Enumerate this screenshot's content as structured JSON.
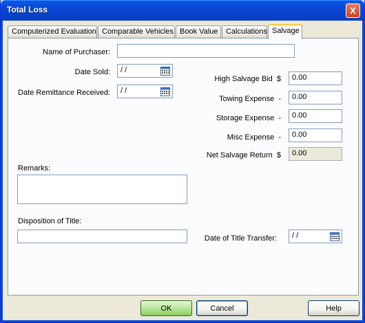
{
  "window": {
    "title": "Total Loss",
    "close_glyph": "X"
  },
  "tabs": [
    {
      "label": "Computerized Evaluation"
    },
    {
      "label": "Comparable Vehicles"
    },
    {
      "label": "Book Value"
    },
    {
      "label": "Calculations"
    },
    {
      "label": "Salvage"
    }
  ],
  "active_tab": "Salvage",
  "form": {
    "name_of_purchaser": {
      "label": "Name of Purchaser:",
      "value": ""
    },
    "date_sold": {
      "label": "Date Sold:",
      "value": " / /"
    },
    "date_remittance": {
      "label": "Date Remittance Received:",
      "value": " / /"
    },
    "remarks": {
      "label": "Remarks:",
      "value": ""
    },
    "disposition": {
      "label": "Disposition of Title:",
      "value": ""
    },
    "date_title_transfer": {
      "label": "Date of Title Transfer:",
      "value": " / /"
    },
    "high_salvage_bid": {
      "label": "High Salvage Bid",
      "symbol": "$",
      "value": "0.00"
    },
    "towing_expense": {
      "label": "Towing Expense",
      "symbol": "-",
      "value": "0.00"
    },
    "storage_expense": {
      "label": "Storage Expense",
      "symbol": "-",
      "value": "0.00"
    },
    "misc_expense": {
      "label": "Misc Expense",
      "symbol": "-",
      "value": "0.00"
    },
    "net_salvage_return": {
      "label": "Net Salvage Return",
      "symbol": "$",
      "value": "0.00"
    }
  },
  "buttons": {
    "ok": "OK",
    "cancel": "Cancel",
    "help": "Help"
  },
  "colors": {
    "titlebar": "#0a46d4",
    "active_tab_highlight": "#ffc73c",
    "dialog_bg": "#ece9d8"
  },
  "icons": {
    "calendar": "calendar-icon",
    "close": "close-icon"
  }
}
